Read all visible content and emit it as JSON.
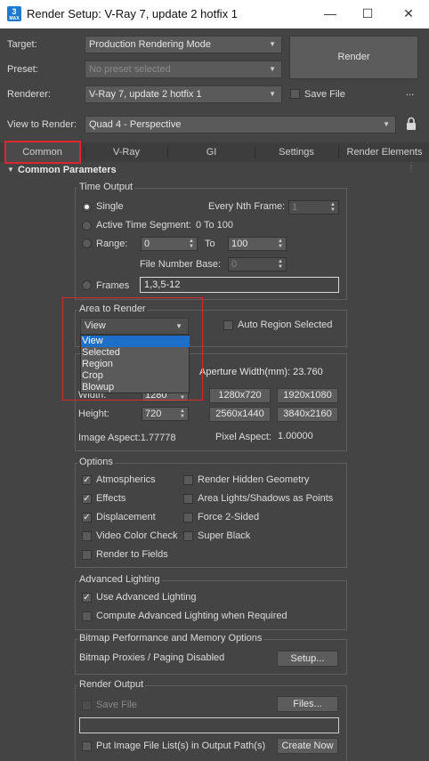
{
  "window": {
    "title": "Render Setup: V-Ray 7, update 2 hotfix 1",
    "icon_text": "3",
    "icon_sub": "MAX",
    "minimize_glyph": "—",
    "maximize_glyph": "☐",
    "close_glyph": "✕"
  },
  "header": {
    "target_label": "Target:",
    "target_value": "Production Rendering Mode",
    "preset_label": "Preset:",
    "preset_value": "No preset selected",
    "renderer_label": "Renderer:",
    "renderer_value": "V-Ray 7, update 2 hotfix 1",
    "save_file_label": "Save File",
    "more_glyph": "...",
    "view_label": "View to Render:",
    "view_value": "Quad 4 - Perspective",
    "render_button": "Render"
  },
  "tabs": [
    "Common",
    "V-Ray",
    "GI",
    "Settings",
    "Render Elements"
  ],
  "rollout": {
    "title": "Common Parameters"
  },
  "time_output": {
    "title": "Time Output",
    "single": "Single",
    "every_nth_label": "Every Nth Frame:",
    "every_nth_value": "1",
    "active_segment_label": "Active Time Segment:",
    "active_segment_value": "0 To 100",
    "range_label": "Range:",
    "range_from": "0",
    "range_to_label": "To",
    "range_to": "100",
    "file_number_base_label": "File Number Base:",
    "file_number_base_value": "0",
    "frames_label": "Frames",
    "frames_value": "1,3,5-12"
  },
  "area_to_render": {
    "title": "Area to Render",
    "selected": "View",
    "auto_region_label": "Auto Region Selected",
    "options": [
      "View",
      "Selected",
      "Region",
      "Crop",
      "Blowup"
    ]
  },
  "output_size": {
    "aperture_label": "Aperture Width(mm): 23.760",
    "width_label": "Width:",
    "width_value": "1280",
    "height_label": "Height:",
    "height_value": "720",
    "presets": [
      "1280x720",
      "1920x1080",
      "2560x1440",
      "3840x2160"
    ],
    "image_aspect": "Image Aspect:1.77778",
    "pixel_aspect_label": "Pixel Aspect:",
    "pixel_aspect_value": "1.00000"
  },
  "options": {
    "title": "Options",
    "atmospherics": "Atmospherics",
    "effects": "Effects",
    "displacement": "Displacement",
    "video_color_check": "Video Color Check",
    "render_to_fields": "Render to Fields",
    "render_hidden": "Render Hidden Geometry",
    "area_lights": "Area Lights/Shadows as Points",
    "force_2sided": "Force 2-Sided",
    "super_black": "Super Black"
  },
  "advanced_lighting": {
    "title": "Advanced Lighting",
    "use_advanced": "Use Advanced Lighting",
    "compute_when_required": "Compute Advanced Lighting when Required"
  },
  "bitmap": {
    "title": "Bitmap Performance and Memory Options",
    "status": "Bitmap Proxies / Paging Disabled",
    "setup_button": "Setup..."
  },
  "render_output": {
    "title": "Render Output",
    "save_file": "Save File",
    "files_button": "Files...",
    "put_image_list": "Put Image File List(s) in Output Path(s)",
    "create_now_button": "Create Now"
  },
  "colors": {
    "highlight_red": "#e0262d",
    "list_selection": "#1e6fc9",
    "panel_bg": "#444444"
  }
}
